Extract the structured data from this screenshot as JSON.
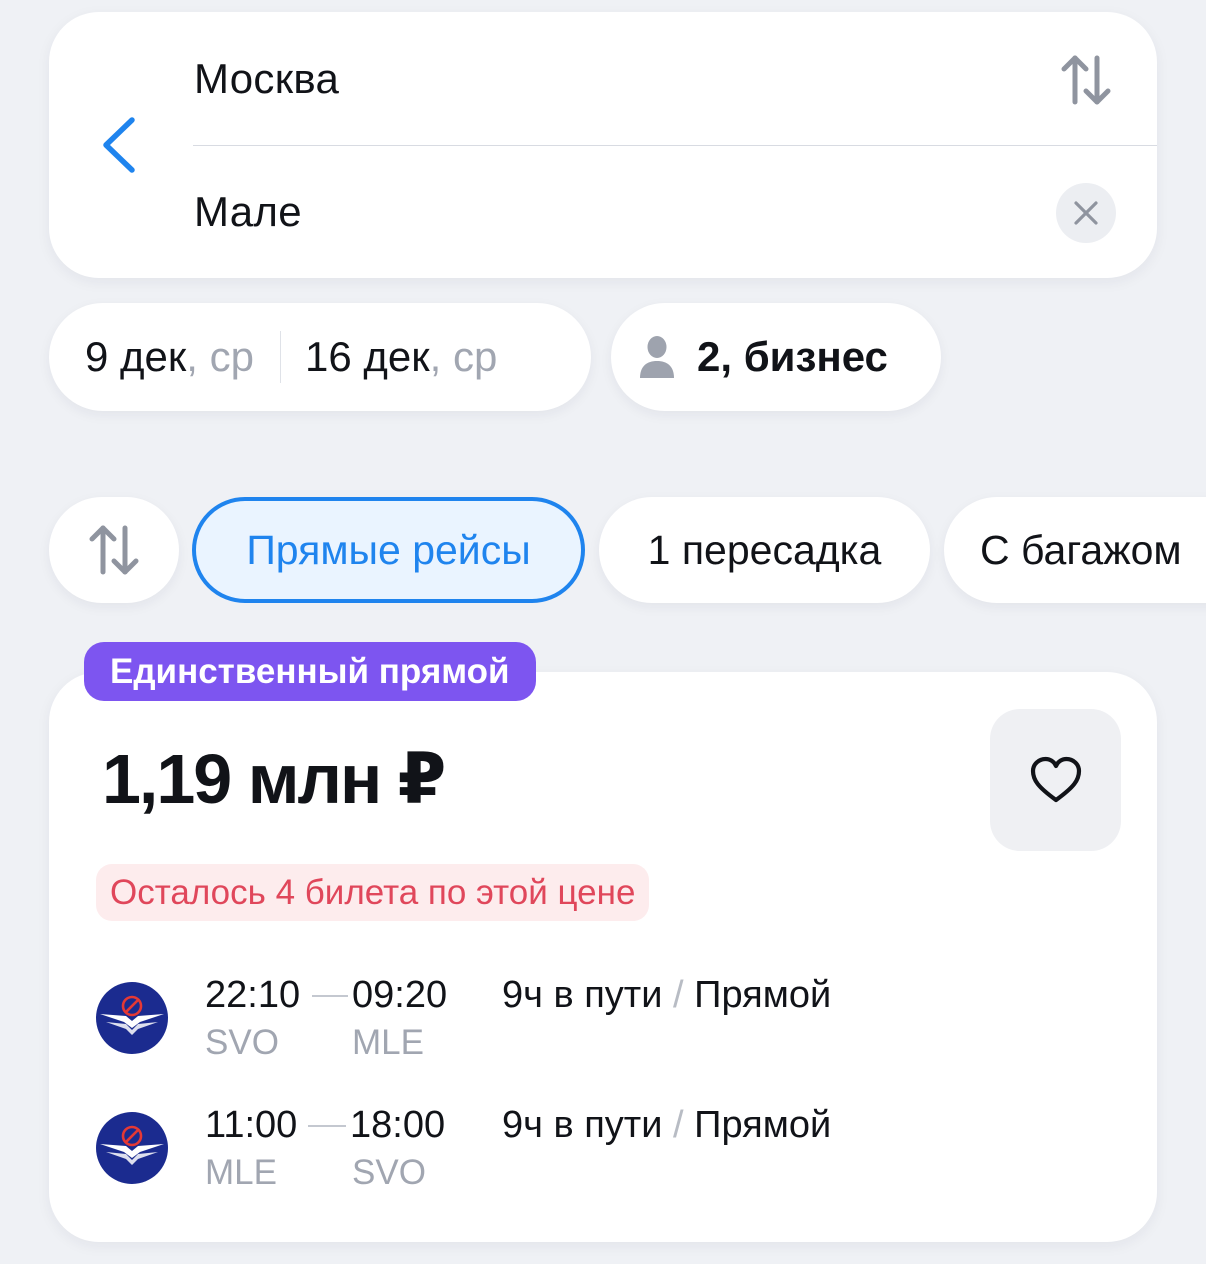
{
  "search": {
    "origin": "Москва",
    "destination": "Мале"
  },
  "dates": {
    "depart_day": "9 дек",
    "depart_dow": ", ср",
    "return_day": "16 дек",
    "return_dow": ", ср"
  },
  "passengers": {
    "label": "2, бизнес"
  },
  "filters": {
    "chips": [
      {
        "label": "Прямые рейсы",
        "selected": true
      },
      {
        "label": "1 пересадка",
        "selected": false
      },
      {
        "label": "С багажом",
        "selected": false
      }
    ]
  },
  "result": {
    "badge": "Единственный прямой",
    "price": "1,19 млн ₽",
    "warning": "Осталось 4 билета по этой цене",
    "segments": [
      {
        "dep_time": "22:10",
        "arr_time": "09:20",
        "dep_code": "SVO",
        "arr_code": "MLE",
        "duration": "9ч в пути",
        "slash": "/",
        "type": "Прямой"
      },
      {
        "dep_time": "11:00",
        "arr_time": "18:00",
        "dep_code": "MLE",
        "arr_code": "SVO",
        "duration": "9ч в пути",
        "slash": "/",
        "type": "Прямой"
      }
    ]
  },
  "colors": {
    "accent": "#1f84ee",
    "badge": "#7d55f0",
    "warning_text": "#e0475b",
    "warning_bg": "#fdeced",
    "airline": "#1b2b8f"
  }
}
